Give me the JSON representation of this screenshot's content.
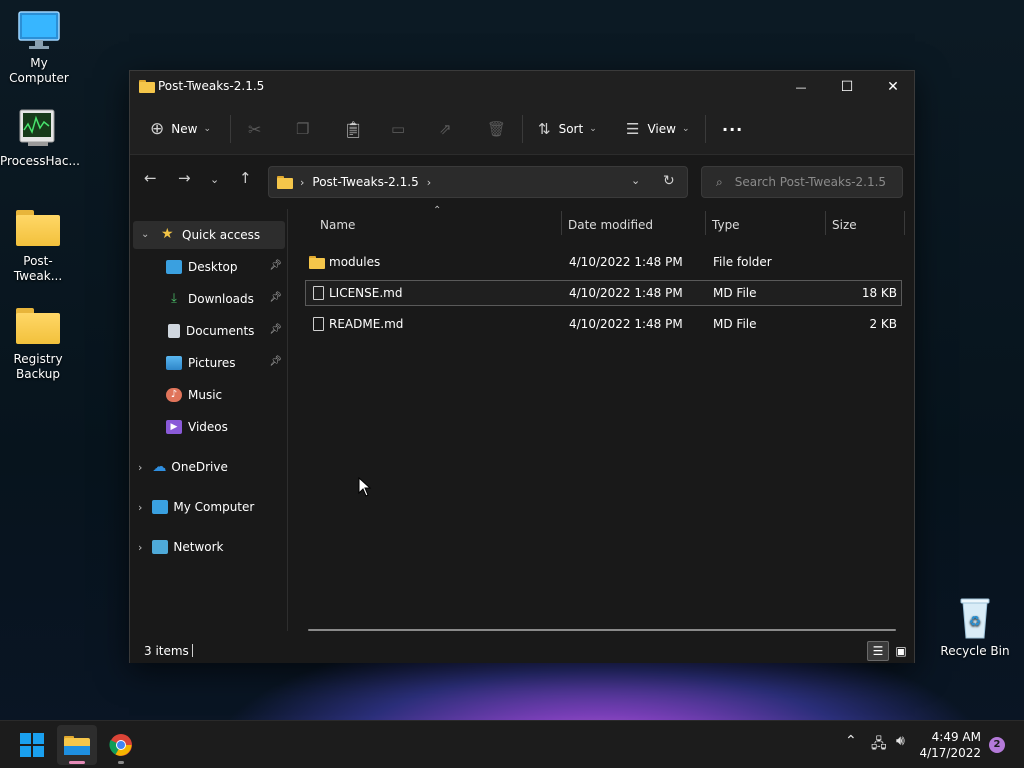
{
  "desktop": {
    "icons": [
      {
        "label": "My Computer"
      },
      {
        "label": "ProcessHac..."
      },
      {
        "label": "Post-Tweak..."
      },
      {
        "label": "Registry Backup"
      },
      {
        "label": "Recycle Bin"
      }
    ]
  },
  "window": {
    "title": "Post-Tweaks-2.1.5",
    "controls": {
      "minimize": "—",
      "maximize": "☐",
      "close": "✕"
    }
  },
  "toolbar": {
    "new_label": "New",
    "sort_label": "Sort",
    "view_label": "View",
    "more_label": "···"
  },
  "address": {
    "path": "Post-Tweaks-2.1.5",
    "search_placeholder": "Search Post-Tweaks-2.1.5"
  },
  "sidebar": {
    "quick_access": "Quick access",
    "items": [
      {
        "label": "Desktop",
        "pinned": true
      },
      {
        "label": "Downloads",
        "pinned": true
      },
      {
        "label": "Documents",
        "pinned": true
      },
      {
        "label": "Pictures",
        "pinned": true
      },
      {
        "label": "Music",
        "pinned": false
      },
      {
        "label": "Videos",
        "pinned": false
      }
    ],
    "roots": [
      {
        "label": "OneDrive"
      },
      {
        "label": "My Computer"
      },
      {
        "label": "Network"
      }
    ]
  },
  "columns": {
    "name": "Name",
    "date": "Date modified",
    "type": "Type",
    "size": "Size"
  },
  "files": [
    {
      "name": "modules",
      "date": "4/10/2022 1:48 PM",
      "type": "File folder",
      "size": ""
    },
    {
      "name": "LICENSE.md",
      "date": "4/10/2022 1:48 PM",
      "type": "MD File",
      "size": "18 KB"
    },
    {
      "name": "README.md",
      "date": "4/10/2022 1:48 PM",
      "type": "MD File",
      "size": "2 KB"
    }
  ],
  "status": {
    "items": "3 items"
  },
  "taskbar": {
    "time": "4:49 AM",
    "date": "4/17/2022",
    "notifications": "2"
  },
  "colors": {
    "accent": "#60cdff",
    "folder": "#f5c64a",
    "notification_badge": "#b47ad9"
  }
}
